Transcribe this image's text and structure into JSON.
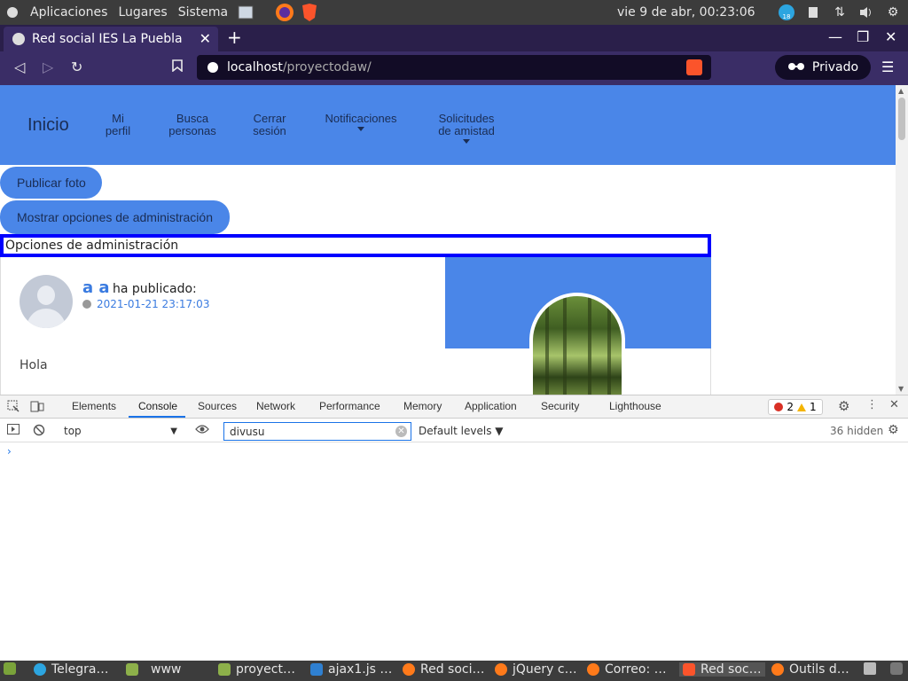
{
  "os_panel": {
    "apps_menu": "Aplicaciones",
    "places_menu": "Lugares",
    "system_menu": "Sistema",
    "clock": "vie  9 de abr, 00:23:06",
    "tray_badge": "18"
  },
  "browser": {
    "tab_title": "Red social IES La Puebla",
    "url_host": "localhost",
    "url_path": "/proyectodaw/",
    "private_label": "Privado"
  },
  "site": {
    "nav": {
      "home": "Inicio",
      "profile_line1": "Mi",
      "profile_line2": "perfil",
      "search_line1": "Busca",
      "search_line2": "personas",
      "logout_line1": "Cerrar",
      "logout_line2": "sesión",
      "notifications": "Notificaciones",
      "friend_requests_line1": "Solicitudes",
      "friend_requests_line2": "de amistad"
    },
    "publish_photo_label": "Publicar foto",
    "show_admin_label": "Mostrar opciones de administración",
    "admin_options_title": "Opciones de administración",
    "post": {
      "author": "a a",
      "action": "ha publicado:",
      "date": "2021-01-21 23:17:03",
      "text": "Hola"
    }
  },
  "devtools": {
    "tabs": [
      "Elements",
      "Console",
      "Sources",
      "Network",
      "Performance",
      "Memory",
      "Application",
      "Security",
      "Lighthouse"
    ],
    "active_tab": "Console",
    "error_count": "2",
    "warning_count": "1",
    "context": "top",
    "filter_value": "divusu",
    "levels_label": "Default levels ▼",
    "hidden_label": "36 hidden",
    "prompt": "›"
  },
  "taskbar": {
    "items": [
      "Telegra…",
      "www",
      "proyect…",
      "ajax1.js …",
      "Red soci…",
      "jQuery c…",
      "Correo: …",
      "Red soc…",
      "Outils d…"
    ]
  },
  "colors": {
    "site_blue": "#4a86e8",
    "admin_border": "#0000ff",
    "browser_purple": "#3a2d66",
    "link_blue": "#3a7be0"
  }
}
